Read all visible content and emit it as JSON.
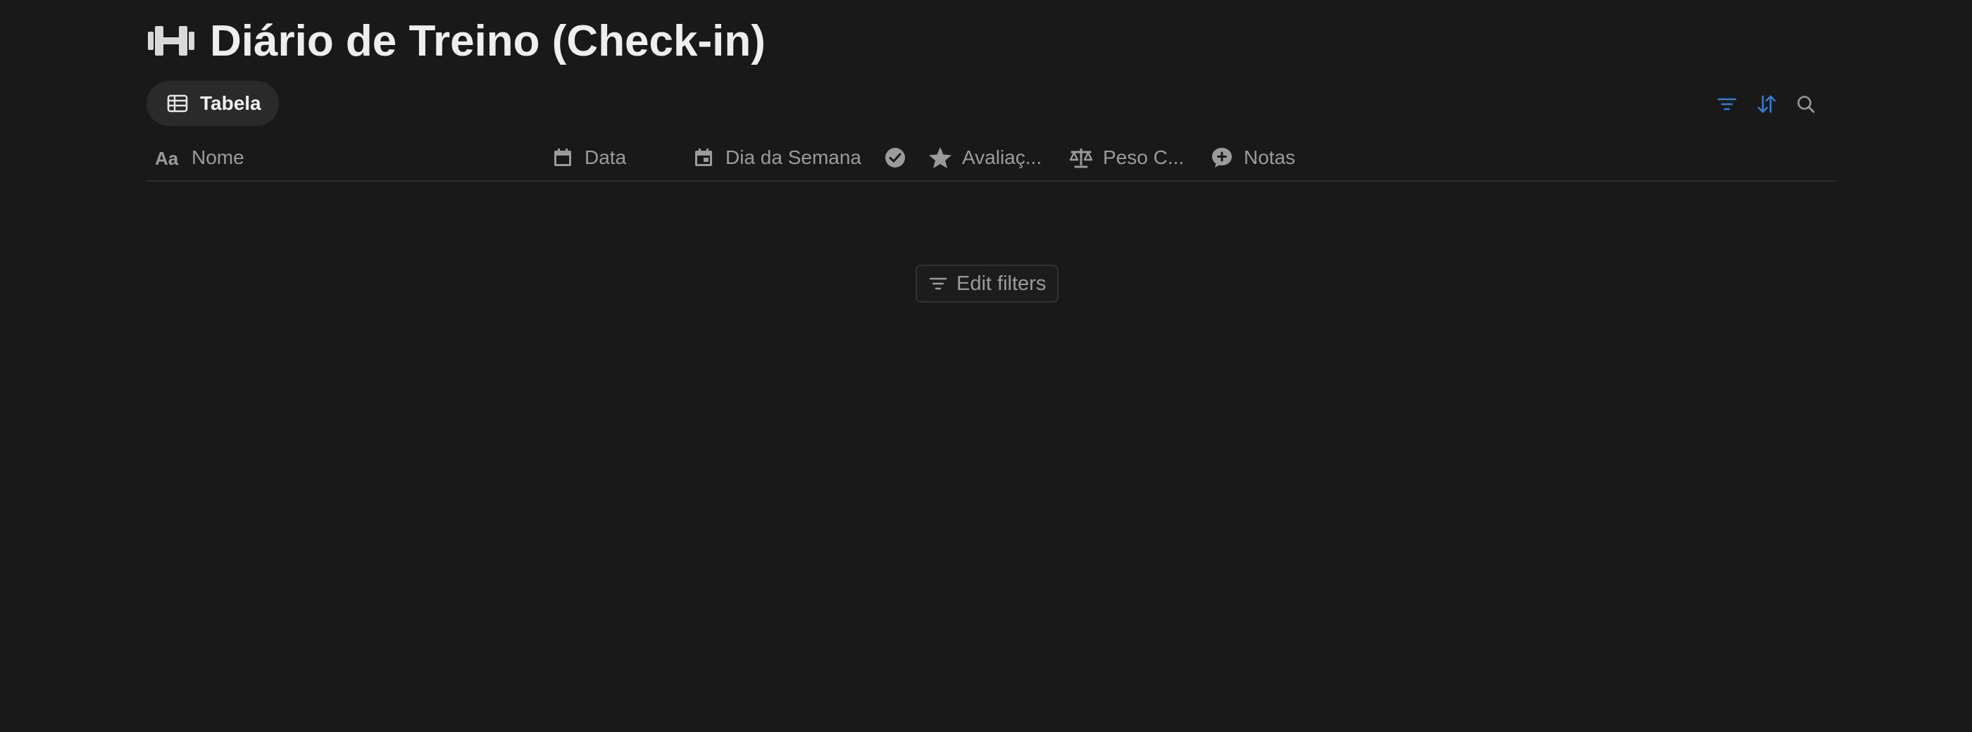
{
  "page": {
    "title": "Diário de Treino (Check-in)",
    "icon": "dumbbell-icon"
  },
  "views": [
    {
      "label": "Tabela",
      "icon": "table-icon",
      "active": true
    }
  ],
  "toolbar": {
    "filter_icon": "filter-icon",
    "sort_icon": "sort-icon",
    "search_icon": "search-icon",
    "accent_color": "#2f7fd8"
  },
  "columns": [
    {
      "label": "Nome",
      "icon": "text-icon"
    },
    {
      "label": "Data",
      "icon": "calendar-icon"
    },
    {
      "label": "Dia da Semana",
      "icon": "calendar-day-icon"
    },
    {
      "label": "",
      "icon": "checkbox-icon"
    },
    {
      "label": "Avaliaç...",
      "icon": "star-icon"
    },
    {
      "label": "Peso C...",
      "icon": "scale-icon"
    },
    {
      "label": "Notas",
      "icon": "comment-icon"
    }
  ],
  "empty_state": {
    "button_label": "Edit filters",
    "icon": "filter-icon"
  }
}
